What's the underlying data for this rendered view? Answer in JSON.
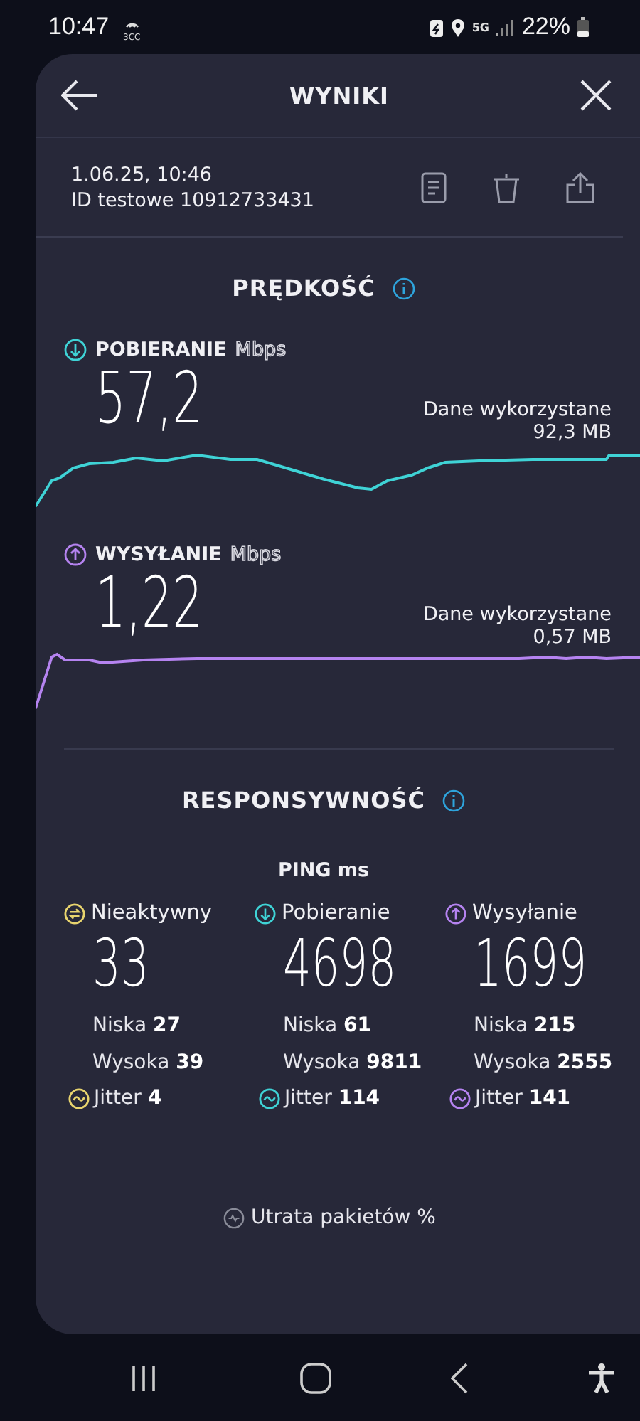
{
  "status_bar": {
    "time": "10:47",
    "hotspot_label": "3CC",
    "network": "5G",
    "battery": "22%"
  },
  "header": {
    "title": "WYNIKI"
  },
  "test": {
    "date": "1.06.25, 10:46",
    "id": "ID testowe 10912733431"
  },
  "speed": {
    "title": "PRĘDKOŚĆ",
    "metrics": [
      {
        "kind": "download",
        "label": "POBIERANIE",
        "unit": "Mbps",
        "value": "57,2",
        "data_label": "Dane wykorzystane",
        "data_value": "92,3 MB",
        "color": "#3fd3d6"
      },
      {
        "kind": "upload",
        "label": "WYSYŁANIE",
        "unit": "Mbps",
        "value": "1,22",
        "data_label": "Dane wykorzystane",
        "data_value": "0,57 MB",
        "color": "#b583f0"
      }
    ]
  },
  "responsiveness": {
    "title": "RESPONSYWNOŚĆ",
    "ping_label": "PING ms",
    "columns": [
      {
        "kind": "idle",
        "label": "Nieaktywny",
        "value": "33",
        "low_label": "Niska",
        "low": "27",
        "high_label": "Wysoka",
        "high": "39",
        "jitter_label": "Jitter",
        "jitter": "4",
        "color": "#e8d46e"
      },
      {
        "kind": "download",
        "label": "Pobieranie",
        "value": "4698",
        "low_label": "Niska",
        "low": "61",
        "high_label": "Wysoka",
        "high": "9811",
        "jitter_label": "Jitter",
        "jitter": "114",
        "color": "#3fd3d6"
      },
      {
        "kind": "upload",
        "label": "Wysyłanie",
        "value": "1699",
        "low_label": "Niska",
        "low": "215",
        "high_label": "Wysoka",
        "high": "2555",
        "jitter_label": "Jitter",
        "jitter": "141",
        "color": "#b583f0"
      }
    ]
  },
  "packet_loss": {
    "label": "Utrata pakietów %"
  }
}
